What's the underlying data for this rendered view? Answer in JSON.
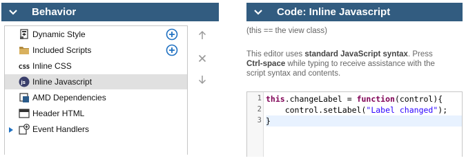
{
  "left_panel": {
    "title": "Behavior",
    "items": [
      {
        "label": "Dynamic Style",
        "icon": "dynamic-style-icon",
        "has_add": true
      },
      {
        "label": "Included Scripts",
        "icon": "folder-icon",
        "has_add": true
      },
      {
        "label": "Inline CSS",
        "icon": "css-icon",
        "has_add": false
      },
      {
        "label": "Inline Javascript",
        "icon": "javascript-icon",
        "has_add": false,
        "selected": true
      },
      {
        "label": "AMD Dependencies",
        "icon": "amd-icon",
        "has_add": false
      },
      {
        "label": "Header HTML",
        "icon": "header-html-icon",
        "has_add": false
      },
      {
        "label": "Event Handlers",
        "icon": "event-handlers-icon",
        "has_add": false,
        "expandable": true
      }
    ],
    "side_buttons": [
      "move-up-icon",
      "delete-icon",
      "move-down-icon"
    ]
  },
  "right_panel": {
    "title": "Code: Inline Javascript",
    "scope_note": "(this == the view class)",
    "help": {
      "prefix": "This editor uses ",
      "syntax": "standard JavaScript syntax",
      "middle": ". Press ",
      "shortcut": "Ctrl-space",
      "suffix_line1": " while typing to receive assistance with the",
      "suffix_line2": "script syntax and contents."
    },
    "code": {
      "line_numbers": [
        "1",
        "2",
        "3"
      ],
      "line1": {
        "this_kw": "this",
        "mid": ".changeLabel = ",
        "fn_kw": "function",
        "end": "(control){"
      },
      "line2": {
        "start": "    control.setLabel(",
        "str": "\"Label changed\"",
        "end": ");"
      },
      "line3": "}"
    }
  },
  "colors": {
    "header_bg": "#325c80",
    "selected_row": "#e0e0e0",
    "add_button": "#1f70c1"
  }
}
